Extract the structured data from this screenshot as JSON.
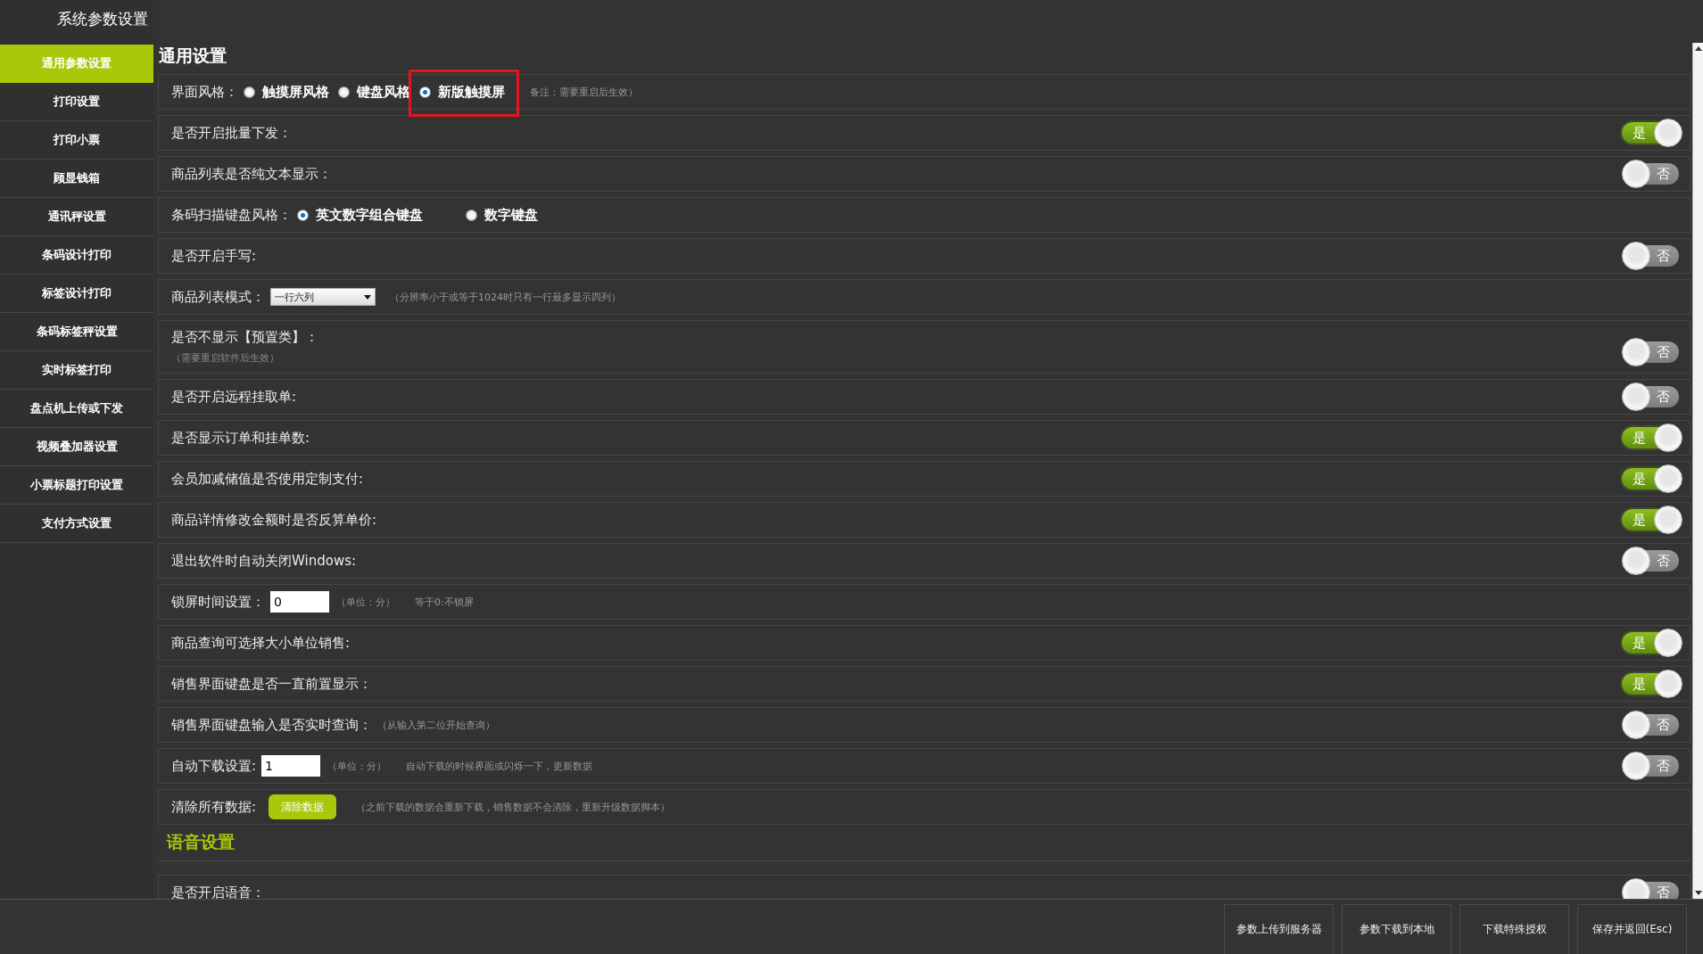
{
  "app_title": "系统参数设置",
  "nav": [
    {
      "label": "通用参数设置",
      "selected": true
    },
    {
      "label": "打印设置",
      "selected": false
    },
    {
      "label": "打印小票",
      "selected": false
    },
    {
      "label": "顾显钱箱",
      "selected": false
    },
    {
      "label": "通讯秤设置",
      "selected": false
    },
    {
      "label": "条码设计打印",
      "selected": false
    },
    {
      "label": "标签设计打印",
      "selected": false
    },
    {
      "label": "条码标签秤设置",
      "selected": false
    },
    {
      "label": "实时标签打印",
      "selected": false
    },
    {
      "label": "盘点机上传或下发",
      "selected": false
    },
    {
      "label": "视频叠加器设置",
      "selected": false
    },
    {
      "label": "小票标题打印设置",
      "selected": false
    },
    {
      "label": "支付方式设置",
      "selected": false
    }
  ],
  "sections": [
    {
      "title": "通用设置",
      "kind": "main",
      "rows": [
        {
          "kind": "radio",
          "label": "界面风格：",
          "options": [
            {
              "label": "触摸屏风格",
              "selected": false,
              "highlighted": false
            },
            {
              "label": "键盘风格",
              "selected": false,
              "highlighted": false
            },
            {
              "label": "新版触摸屏",
              "selected": true,
              "highlighted": true
            }
          ],
          "note": "备注：需要重启后生效）"
        },
        {
          "kind": "toggle",
          "label": "是否开启批量下发：",
          "toggle": {
            "on": true,
            "text": "是"
          }
        },
        {
          "kind": "toggle",
          "label": "商品列表是否纯文本显示：",
          "toggle": {
            "on": false,
            "text": "否"
          }
        },
        {
          "kind": "radio",
          "label": "条码扫描键盘风格：",
          "options": [
            {
              "label": "英文数字组合键盘",
              "selected": true,
              "highlighted": false
            },
            {
              "label": "数字键盘",
              "selected": false,
              "highlighted": false
            }
          ]
        },
        {
          "kind": "toggle",
          "label": "是否开启手写:",
          "toggle": {
            "on": false,
            "text": "否"
          }
        },
        {
          "kind": "select",
          "label": "商品列表模式：",
          "value": "一行六列",
          "note": "（分辨率小于或等于1024时只有一行最多显示四列）"
        },
        {
          "kind": "toggle",
          "label": "是否不显示【预置类】：",
          "sub_note": "（需要重启软件后生效）",
          "toggle": {
            "on": false,
            "text": "否"
          }
        },
        {
          "kind": "toggle",
          "label": "是否开启远程挂取单:",
          "toggle": {
            "on": false,
            "text": "否"
          }
        },
        {
          "kind": "toggle",
          "label": "是否显示订单和挂单数:",
          "toggle": {
            "on": true,
            "text": "是"
          }
        },
        {
          "kind": "toggle",
          "label": "会员加减储值是否使用定制支付:",
          "toggle": {
            "on": true,
            "text": "是"
          }
        },
        {
          "kind": "toggle",
          "label": "商品详情修改金额时是否反算单价:",
          "toggle": {
            "on": true,
            "text": "是"
          }
        },
        {
          "kind": "toggle",
          "label": "退出软件时自动关闭Windows:",
          "toggle": {
            "on": false,
            "text": "否"
          }
        },
        {
          "kind": "input",
          "label": "锁屏时间设置：",
          "value": "0",
          "unit": "（单位：分）",
          "note": "等于0:不锁屏"
        },
        {
          "kind": "toggle",
          "label": "商品查询可选择大小单位销售:",
          "toggle": {
            "on": true,
            "text": "是"
          }
        },
        {
          "kind": "toggle",
          "label": "销售界面键盘是否一直前置显示：",
          "toggle": {
            "on": true,
            "text": "是"
          }
        },
        {
          "kind": "toggle",
          "label": "销售界面键盘输入是否实时查询：",
          "note": "（从输入第二位开始查询）",
          "toggle": {
            "on": false,
            "text": "否"
          }
        },
        {
          "kind": "input",
          "label": "自动下载设置:",
          "value": "1",
          "unit": "（单位：分）",
          "note": "自动下载的时候界面或闪烁一下，更新数据",
          "toggle": {
            "on": false,
            "text": "否"
          }
        },
        {
          "kind": "button",
          "label": "清除所有数据:",
          "button": "清除数据",
          "note": "（之前下载的数据会重新下载，销售数据不会清除，重新升级数据脚本）"
        }
      ]
    },
    {
      "title": "语音设置",
      "kind": "sub",
      "rows": [
        {
          "kind": "toggle",
          "label": "是否开启语音：",
          "toggle": {
            "on": false,
            "text": "否"
          }
        }
      ]
    }
  ],
  "actions": [
    "参数上传到服务器",
    "参数下载到本地",
    "下载特殊授权",
    "保存并返回(Esc)"
  ]
}
